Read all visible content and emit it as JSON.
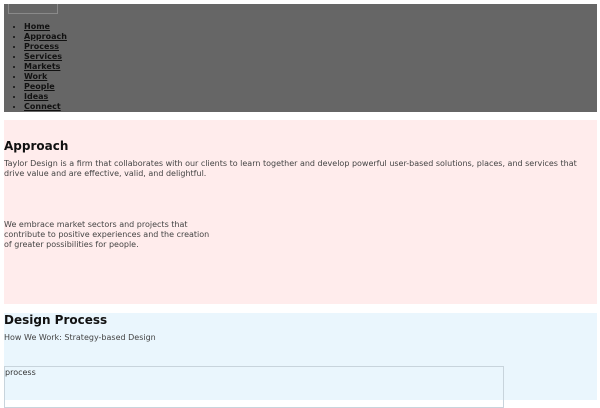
{
  "nav": {
    "items": [
      "Home",
      "Approach",
      "Process",
      "Services",
      "Markets",
      "Work",
      "People",
      "Ideas",
      "Connect"
    ]
  },
  "approach": {
    "title": "Approach",
    "paragraph1": "Taylor Design is a firm that collaborates with our clients to learn together and develop powerful user-based solutions, places, and services that drive value and are effective, valid, and delightful.",
    "paragraph2": "We embrace market sectors and projects that contribute to positive experiences and the creation of greater possibilities for people."
  },
  "process": {
    "title": "Design Process",
    "subtitle": "How We Work: Strategy-based Design",
    "image_alt": "process"
  },
  "colors": {
    "header_bg": "#666666",
    "approach_bg": "#ffecec",
    "process_bg": "#eaf6fd"
  }
}
